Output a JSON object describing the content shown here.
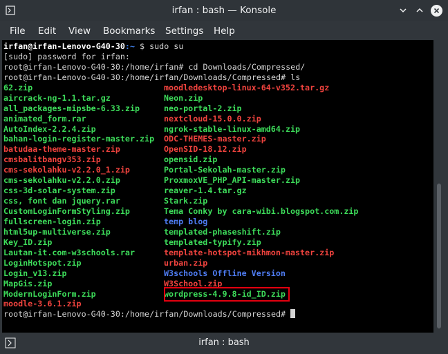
{
  "window": {
    "title": "irfan : bash — Konsole"
  },
  "menu": [
    "File",
    "Edit",
    "View",
    "Bookmarks",
    "Settings",
    "Help"
  ],
  "terminal": {
    "prompt1": {
      "user": "irfan@irfan-Lenovo-G40-30",
      "path": ":~",
      "command": " $ sudo su"
    },
    "sudo_prompt": "[sudo] password for irfan:",
    "cmd_cd": "root@irfan-Lenovo-G40-30:/home/irfan# cd Downloads/Compressed/",
    "cmd_ls": "root@irfan-Lenovo-G40-30:/home/irfan/Downloads/Compressed# ls",
    "files_left": [
      {
        "name": "62.zip",
        "color": "green"
      },
      {
        "name": "aircrack-ng-1.1.tar.gz",
        "color": "green"
      },
      {
        "name": "all_packages-mipsbe-6.33.zip",
        "color": "green"
      },
      {
        "name": "animated_form.rar",
        "color": "green"
      },
      {
        "name": "AutoIndex-2.2.4.zip",
        "color": "green"
      },
      {
        "name": "bahan-login-register-master.zip",
        "color": "green"
      },
      {
        "name": "batudaa-theme-master.zip",
        "color": "red"
      },
      {
        "name": "cmsbalitbangv353.zip",
        "color": "red"
      },
      {
        "name": "cms-sekolahku-v2.2.0_1.zip",
        "color": "red"
      },
      {
        "name": "cms-sekolahku-v2.2.0.zip",
        "color": "green"
      },
      {
        "name": "css-3d-solar-system.zip",
        "color": "green"
      },
      {
        "name": "css, font dan jquery.rar",
        "color": "green"
      },
      {
        "name": "CustomLoginFormStyling.zip",
        "color": "green"
      },
      {
        "name": "fullscreen-login.zip",
        "color": "green"
      },
      {
        "name": "html5up-multiverse.zip",
        "color": "green"
      },
      {
        "name": "Key_ID.zip",
        "color": "green"
      },
      {
        "name": "Lautan-it.com-w3schools.rar",
        "color": "green"
      },
      {
        "name": "LoginHotspot.zip",
        "color": "green"
      },
      {
        "name": "Login_v13.zip",
        "color": "green"
      },
      {
        "name": "MapGis.zip",
        "color": "green"
      },
      {
        "name": "ModernLoginForm.zip",
        "color": "green"
      },
      {
        "name": "moodle-3.6.1.zip",
        "color": "red"
      }
    ],
    "files_right": [
      {
        "name": "moodledesktop-linux-64-v352.tar.gz",
        "color": "red"
      },
      {
        "name": "Neon.zip",
        "color": "green"
      },
      {
        "name": "neo-portal-2.zip",
        "color": "green"
      },
      {
        "name": "nextcloud-15.0.0.zip",
        "color": "red"
      },
      {
        "name": "ngrok-stable-linux-amd64.zip",
        "color": "green"
      },
      {
        "name": "ODC-THEMES-master.zip",
        "color": "red"
      },
      {
        "name": "OpenSID-18.12.zip",
        "color": "red"
      },
      {
        "name": "opensid.zip",
        "color": "green"
      },
      {
        "name": "Portal-Sekolah-master.zip",
        "color": "green"
      },
      {
        "name": "ProxmoxVE_PHP_API-master.zip",
        "color": "green"
      },
      {
        "name": "reaver-1.4.tar.gz",
        "color": "green"
      },
      {
        "name": "Stark.zip",
        "color": "green"
      },
      {
        "name": "Tema Conky by cara-wibi.blogspot.com.zip",
        "color": "green"
      },
      {
        "name": "temp blog",
        "color": "blue"
      },
      {
        "name": "templated-phaseshift.zip",
        "color": "green"
      },
      {
        "name": "templated-typify.zip",
        "color": "green"
      },
      {
        "name": "template-hotspot-mikhmon-master.zip",
        "color": "red"
      },
      {
        "name": "urban.zip",
        "color": "red"
      },
      {
        "name": "W3schools Offline Version",
        "color": "blue"
      },
      {
        "name": "W3School.zip",
        "color": "red"
      },
      {
        "name": "wordpress-4.9.8-id_ID.zip",
        "color": "green",
        "highlighted": true
      },
      {
        "name": "",
        "color": "green"
      }
    ],
    "final_prompt": "root@irfan-Lenovo-G40-30:/home/irfan/Downloads/Compressed# "
  },
  "tab": {
    "label": "irfan : bash"
  },
  "colors": {
    "green": "#3ddc5a",
    "red": "#f0433e",
    "blue": "#4e7cf2",
    "highlight_border": "#e4000f"
  }
}
